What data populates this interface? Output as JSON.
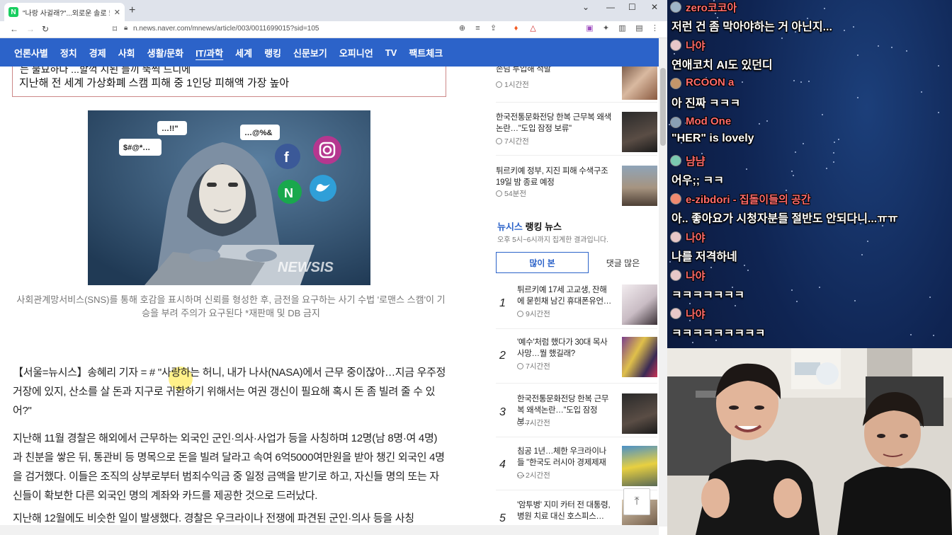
{
  "browser": {
    "tab_title": "\"나랑 사귈래?\"...외로운 솔로 또 ...",
    "url": "n.news.naver.com/mnews/article/003/0011699015?sid=105",
    "favicon_letter": "N"
  },
  "gnb": {
    "items": [
      "언론사별",
      "정치",
      "경제",
      "사회",
      "생활/문화",
      "IT/과학",
      "세계",
      "랭킹",
      "신문보기",
      "오피니언",
      "TV",
      "팩트체크"
    ],
    "active": "IT/과학"
  },
  "article": {
    "summary_prev": "는 불묘하다 ...할꺽 지된 들끼 뚝씩 드디에",
    "summary_line": "지난해 전 세계 가상화폐 스캠 피해 중 1인당 피해액 가장 높아",
    "photo_text": {
      "bubble1": "…!!\"",
      "bubble2": "…@%&",
      "bubble3": "$#@*…",
      "watermark": "NEWSIS"
    },
    "caption": "사회관계망서비스(SNS)를 통해 호감을 표시하며 신뢰를 형성한 후, 금전을 요구하는 사기 수법 '로맨스 스캠'이 기승을 부려 주의가 요구된다 *재판매 및 DB 금지",
    "para1": "【서울=뉴시스】송혜리 기자 = # \"사랑하는 허니, 내가 나사(NASA)에서 근무 중이잖아…지금 우주정거장에 있지, 산소를 살 돈과 지구로 귀환하기 위해서는 여권 갱신이 필요해 혹시 돈 좀 빌려 줄 수 있어?\"",
    "para2": "지난해 11월 경찰은 해외에서 근무하는 외국인 군인·의사·사업가 등을 사칭하며 12명(남 8명·여 4명)과 친분을 쌓은 뒤, 통관비 등 명목으로 돈을 빌려 달라고 속여 6억5000여만원을 받아 챙긴 외국인 4명을 검거했다. 이들은 조직의 상부로부터 범죄수익금 중 일정 금액을 받기로 하고, 자신들 명의 또는 자신들이 확보한 다른 외국인 명의 계좌와 카드를 제공한 것으로 드러났다.",
    "para3": "지난해 12월에도 비슷한 일이 발생했다. 경찰은 우크라이나 전쟁에 파견된 군인·의사 등을 사칭"
  },
  "rail": {
    "top_items": [
      {
        "title": "손님 투입해 적발",
        "time": "1시간전"
      },
      {
        "title": "한국전통문화전당 한복 근무복 왜색논란…\"도입 잠정 보류\"",
        "time": "7시간전"
      },
      {
        "title": "튀르키예 정부, 지진 피해 수색구조 19일 밤 종료 예정",
        "time": "54분전"
      }
    ],
    "ranking_brand": "뉴시스",
    "ranking_title": "랭킹 뉴스",
    "ranking_sub": "오후 5시~6시까지 집계한 결과입니다.",
    "tab_most_viewed": "많이 본",
    "tab_most_commented": "댓글 많은",
    "ranking": [
      {
        "num": "1",
        "title": "튀르키예 17세 고교생, 잔해에 묻힌채 남긴 휴대폰유언…",
        "time": "9시간전"
      },
      {
        "num": "2",
        "title": "'예수'처럼 했다가 30대 목사 사망…뭘 했길래?",
        "time": "7시간전"
      },
      {
        "num": "3",
        "title": "한국전통문화전당 한복 근무복 왜색논란…\"도입 잠정 보…",
        "time": "7시간전"
      },
      {
        "num": "4",
        "title": "침공 1년…체한 우크라이나들 \"한국도 러시아 경제제재 …",
        "time": "2시간전"
      },
      {
        "num": "5",
        "title": "'암투병' 지미 카터 전 대통령, 병원 치료 대신 호스피스…",
        "time": ""
      }
    ]
  },
  "chat": [
    {
      "name": "zero코코아",
      "text": "저런 건 좀 막아야하는 거 아닌지...",
      "color": "#ff6b6b"
    },
    {
      "name": "나야",
      "text": "연애코치 AI도 있던디",
      "color": "#ff6b6b"
    },
    {
      "name": "RCOON a",
      "text": "아 진짜 ㅋㅋㅋ",
      "color": "#ff6b6b"
    },
    {
      "name": "Mod One",
      "text": "\"HER\" is lovely",
      "color": "#ff6b6b"
    },
    {
      "name": "냠냠",
      "text": "어우;; ㅋㅋ",
      "color": "#ff6b6b"
    },
    {
      "name": "e-zibdori - 집돌이들의 공간",
      "text": "아.. 좋아요가 시청자분들 절반도 안되다니...ㅠㅠ",
      "color": "#ff6b6b"
    },
    {
      "name": "나야",
      "text": "나를 저격하네",
      "color": "#ff6b6b"
    },
    {
      "name": "나야",
      "text": "ㅋㅋㅋㅋㅋㅋㅋ",
      "color": "#ff6b6b"
    },
    {
      "name": "나야",
      "text": "ㅋㅋㅋㅋㅋㅋㅋㅋㅋ",
      "color": "#ff6b6b"
    }
  ],
  "colors": {
    "naver_blue": "#2c63c9",
    "naver_green": "#19ce60",
    "chat_name": "#ff6b6b"
  }
}
